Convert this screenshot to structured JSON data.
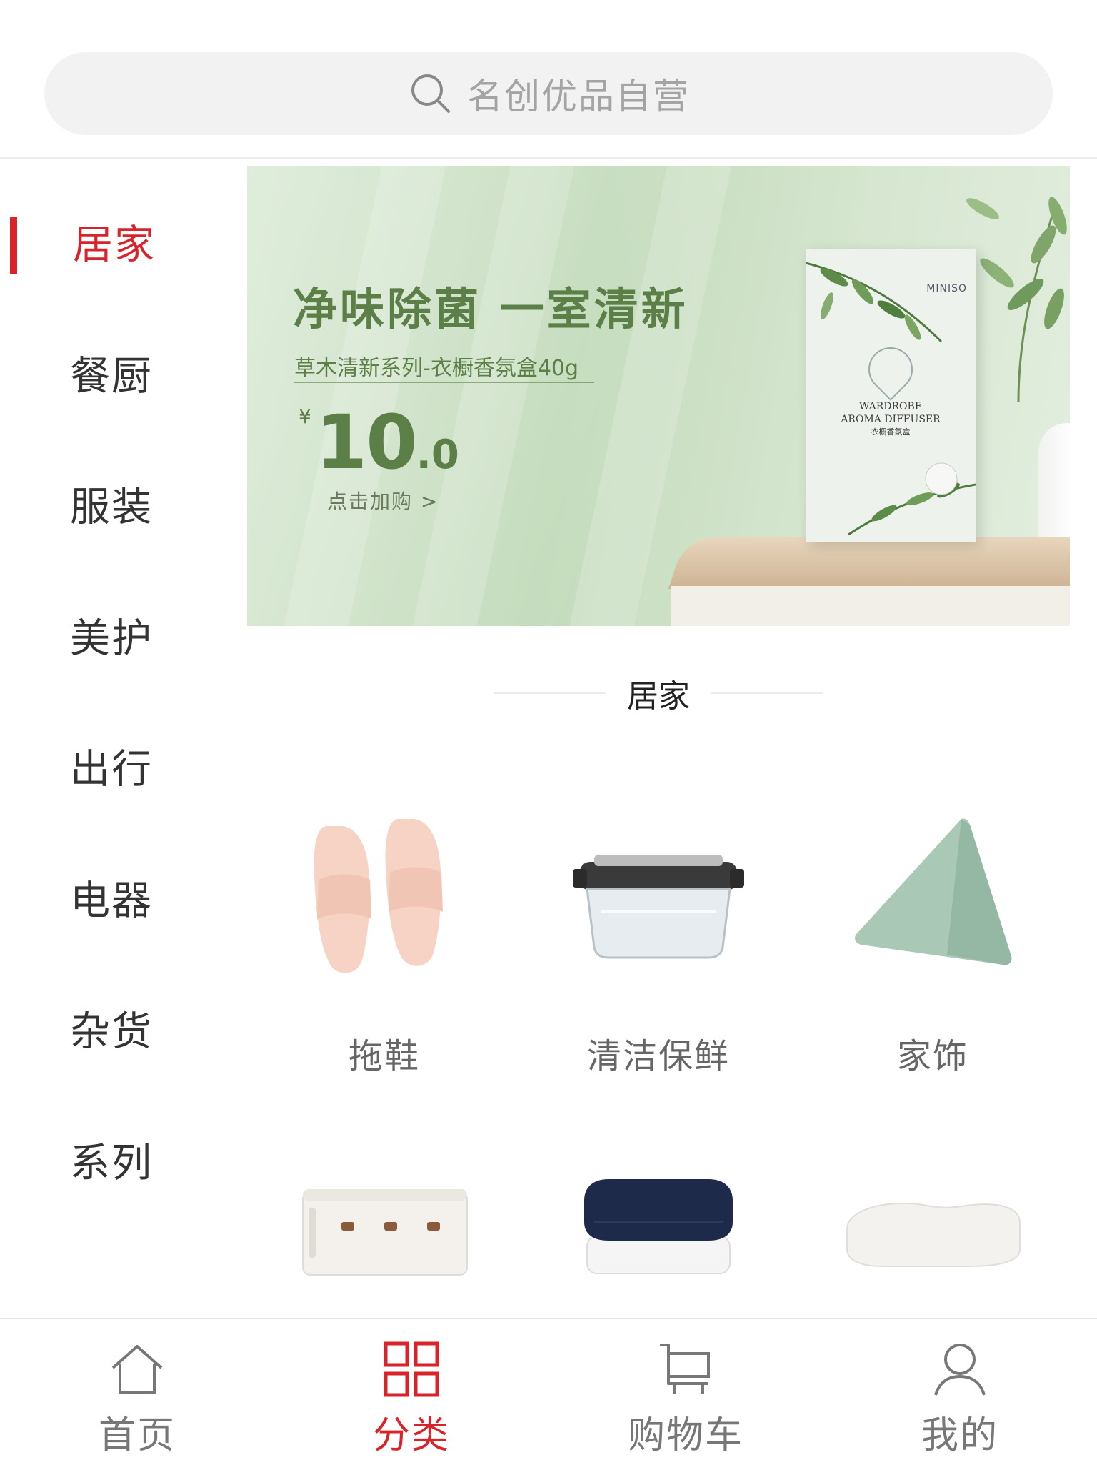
{
  "search": {
    "placeholder": "名创优品自营"
  },
  "sidebar": {
    "active_index": 0,
    "items": [
      {
        "label": "居家"
      },
      {
        "label": "餐厨"
      },
      {
        "label": "服装"
      },
      {
        "label": "美护"
      },
      {
        "label": "出行"
      },
      {
        "label": "电器"
      },
      {
        "label": "杂货"
      },
      {
        "label": "系列"
      }
    ]
  },
  "banner": {
    "headline": "净味除菌  一室清新",
    "subtitle": "草木清新系列-衣橱香氛盒40g",
    "price_currency": "¥",
    "price_integer": "10",
    "price_decimal": ".0",
    "cta": "点击加购  >",
    "product_brand": "MINISO",
    "product_title_line1": "WARDROBE",
    "product_title_line2": "AROMA DIFFUSER",
    "product_title_line3": "衣橱香氛盒"
  },
  "section": {
    "title": "居家"
  },
  "categories": [
    {
      "label": "拖鞋",
      "icon": "slippers-image"
    },
    {
      "label": "清洁保鲜",
      "icon": "food-container-image"
    },
    {
      "label": "家饰",
      "icon": "cushion-image"
    },
    {
      "label": "",
      "icon": "cable-box-image"
    },
    {
      "label": "",
      "icon": "towel-image"
    },
    {
      "label": "",
      "icon": "pillow-image"
    }
  ],
  "tabbar": {
    "active_index": 1,
    "tabs": [
      {
        "label": "首页",
        "icon": "home-icon"
      },
      {
        "label": "分类",
        "icon": "grid-icon"
      },
      {
        "label": "购物车",
        "icon": "cart-icon"
      },
      {
        "label": "我的",
        "icon": "user-icon"
      }
    ]
  },
  "colors": {
    "accent": "#d8232a",
    "banner_text": "#5b7f47",
    "search_bg": "#f2f2f2"
  }
}
